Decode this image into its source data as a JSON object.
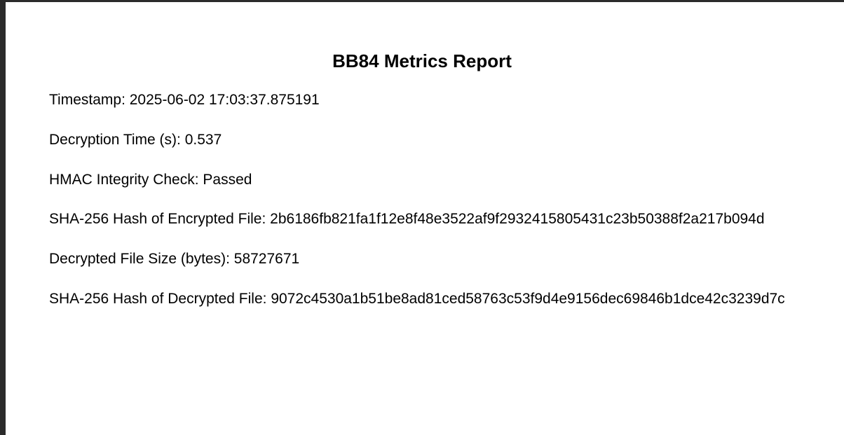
{
  "report": {
    "title": "BB84 Metrics Report",
    "lines": [
      {
        "label": "Timestamp: ",
        "value": "2025-06-02 17:03:37.875191"
      },
      {
        "label": "Decryption Time (s): ",
        "value": "0.537"
      },
      {
        "label": "HMAC Integrity Check: ",
        "value": "Passed"
      },
      {
        "label": "SHA-256 Hash of Encrypted File: ",
        "value": "2b6186fb821fa1f12e8f48e3522af9f2932415805431c23b50388f2a217b094d"
      },
      {
        "label": "Decrypted File Size (bytes): ",
        "value": "58727671"
      },
      {
        "label": "SHA-256 Hash of Decrypted File: ",
        "value": "9072c4530a1b51be8ad81ced58763c53f9d4e9156dec69846b1dce42c3239d7c"
      }
    ]
  }
}
